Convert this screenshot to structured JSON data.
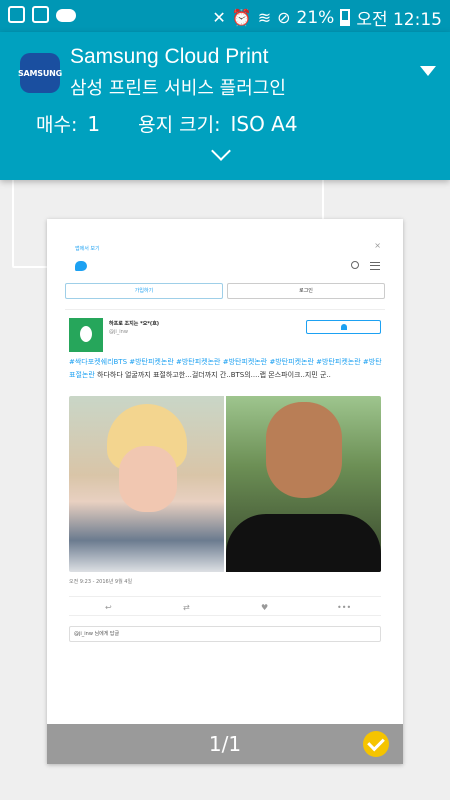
{
  "status_bar": {
    "battery": "21%",
    "time": "오전 12:15"
  },
  "header": {
    "logo_text": "SAMSUNG",
    "title": "Samsung Cloud Print",
    "subtitle": "삼성 프린트 서비스 플러그인",
    "copies_label": "매수:",
    "copies_value": "1",
    "paper_label": "용지 크기:",
    "paper_value": "ISO A4"
  },
  "preview": {
    "app_open": "앱에서 보기",
    "signup": "가입하기",
    "login": "로그인",
    "display_name": "하프로 조지는 *오*(흐)",
    "handle": "@ji_inw",
    "tweet_text": "#싹다포켓쉐리BTS #방탄피켓논란 #방탄피켓논란 #방탄피켓논란 #방탄피켓논란 #방탄피켓논란 #방탄표절논란 ",
    "tweet_tail": "하다하다 얼굴까지 표절하고한...걸더까지 간..BTS의....랩 몬스파이크..지민 군..",
    "date": "오전 9:23 - 2016년 9월 4일",
    "reply_placeholder": "@ji_inw 님에게 답글"
  },
  "footer": {
    "page_indicator": "1/1"
  }
}
